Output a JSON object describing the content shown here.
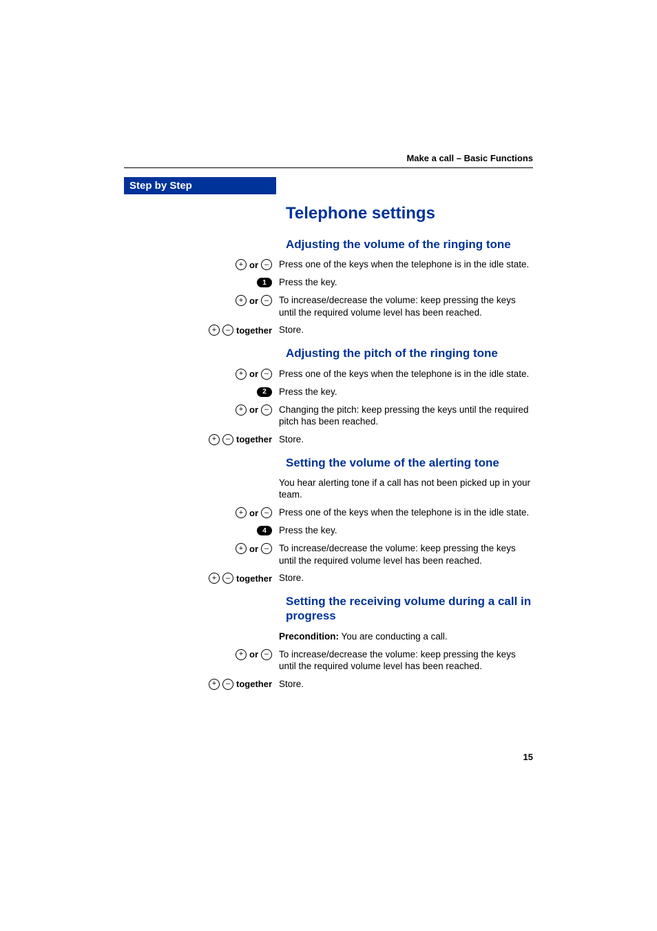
{
  "header": {
    "running_title": "Make a call – Basic Functions"
  },
  "sidebar": {
    "title": "Step by Step"
  },
  "labels": {
    "or": "or",
    "together": "together",
    "plus": "+",
    "minus": "–"
  },
  "main": {
    "title": "Telephone settings",
    "sections": [
      {
        "title": "Adjusting the volume of the ringing tone",
        "steps": [
          {
            "left": {
              "type": "plus-or-minus"
            },
            "right": "Press one of the keys when the telephone is in the idle state."
          },
          {
            "left": {
              "type": "numkey",
              "value": "1"
            },
            "right": "Press the key."
          },
          {
            "left": {
              "type": "plus-or-minus"
            },
            "right": "To increase/decrease the volume: keep pressing the keys until the required volume level has been reached."
          },
          {
            "left": {
              "type": "plus-minus-together"
            },
            "right": "Store."
          }
        ]
      },
      {
        "title": "Adjusting the pitch of the ringing tone",
        "steps": [
          {
            "left": {
              "type": "plus-or-minus"
            },
            "right": "Press one of the keys when the telephone is in the idle state."
          },
          {
            "left": {
              "type": "numkey",
              "value": "2"
            },
            "right": "Press the key."
          },
          {
            "left": {
              "type": "plus-or-minus"
            },
            "right": "Changing the pitch: keep pressing the keys until the required pitch has been reached."
          },
          {
            "left": {
              "type": "plus-minus-together"
            },
            "right": "Store."
          }
        ]
      },
      {
        "title": "Setting the volume of the alerting tone",
        "intro": "You hear alerting tone if a call has not been picked up in your team.",
        "steps": [
          {
            "left": {
              "type": "plus-or-minus"
            },
            "right": "Press one of the keys when the telephone is in the idle state."
          },
          {
            "left": {
              "type": "numkey",
              "value": "4"
            },
            "right": "Press the key."
          },
          {
            "left": {
              "type": "plus-or-minus"
            },
            "right": "To increase/decrease the volume: keep pressing the keys until the required volume level has been reached."
          },
          {
            "left": {
              "type": "plus-minus-together"
            },
            "right": "Store."
          }
        ]
      },
      {
        "title": "Setting the receiving volume during a call in progress",
        "precondition_label": "Precondition:",
        "precondition_text": " You are conducting a call.",
        "steps": [
          {
            "left": {
              "type": "plus-or-minus"
            },
            "right": "To increase/decrease the volume: keep pressing the keys until the required volume level has been reached."
          },
          {
            "left": {
              "type": "plus-minus-together"
            },
            "right": "Store."
          }
        ]
      }
    ]
  },
  "page_number": "15"
}
